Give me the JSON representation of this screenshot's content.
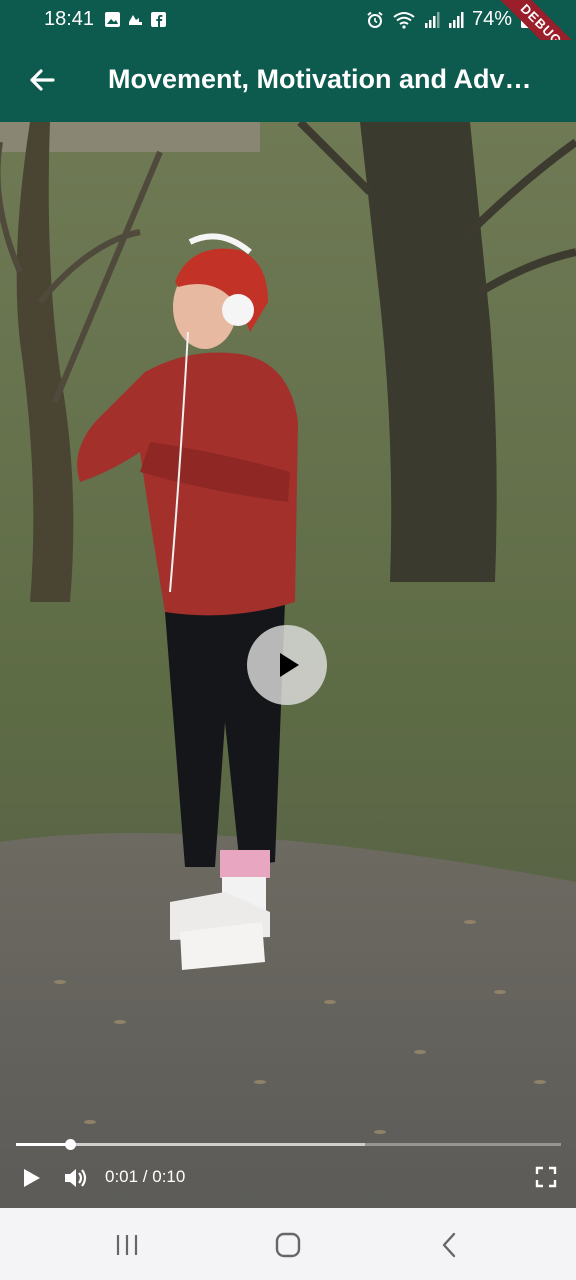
{
  "status_bar": {
    "time": "18:41",
    "left_icons": [
      "gallery-icon",
      "cloud-icon",
      "facebook-icon"
    ],
    "right_icons": [
      "alarm-icon",
      "wifi-icon",
      "signal-icon",
      "signal-icon-2",
      "battery-icon"
    ],
    "battery": "74%",
    "debug_label": "DEBUG"
  },
  "app_bar": {
    "back_icon": "arrow-back-icon",
    "title": "Movement, Motivation and Adv…",
    "background_color": "#0d5a4e"
  },
  "video": {
    "center_control_icon": "play-icon",
    "progress": {
      "played_fraction": 0.1,
      "buffered_fraction": 0.64
    },
    "time": "0:01 / 0:10",
    "controls": [
      "play-icon",
      "volume-icon",
      "fullscreen-icon"
    ]
  },
  "nav_bar": {
    "buttons": [
      "recents-icon",
      "home-icon",
      "back-icon"
    ]
  }
}
